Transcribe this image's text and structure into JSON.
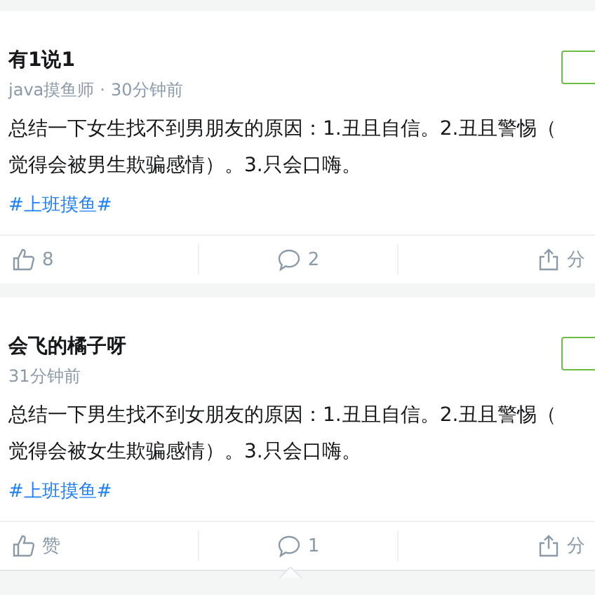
{
  "posts": [
    {
      "author": "有1说1",
      "meta": [
        "java摸鱼师",
        "30分钟前"
      ],
      "meta_separator": "·",
      "content_lines": [
        "总结一下女生找不到男朋友的原因：1.丑且自信。2.丑且警惕（",
        "觉得会被男生欺骗感情）。3.只会口嗨。"
      ],
      "topic": "#上班摸鱼#",
      "actions": {
        "like": "8",
        "comment": "2",
        "share": "分"
      },
      "comments_open": false
    },
    {
      "author": "会飞的橘子呀",
      "meta": [
        "31分钟前"
      ],
      "content_lines": [
        "总结一下男生找不到女朋友的原因：1.丑且自信。2.丑且警惕（",
        "觉得会被女生欺骗感情）。3.只会口嗨。"
      ],
      "topic": "#上班摸鱼#",
      "actions": {
        "like": "赞",
        "comment": "1",
        "share": "分"
      },
      "comments_open": true
    }
  ]
}
